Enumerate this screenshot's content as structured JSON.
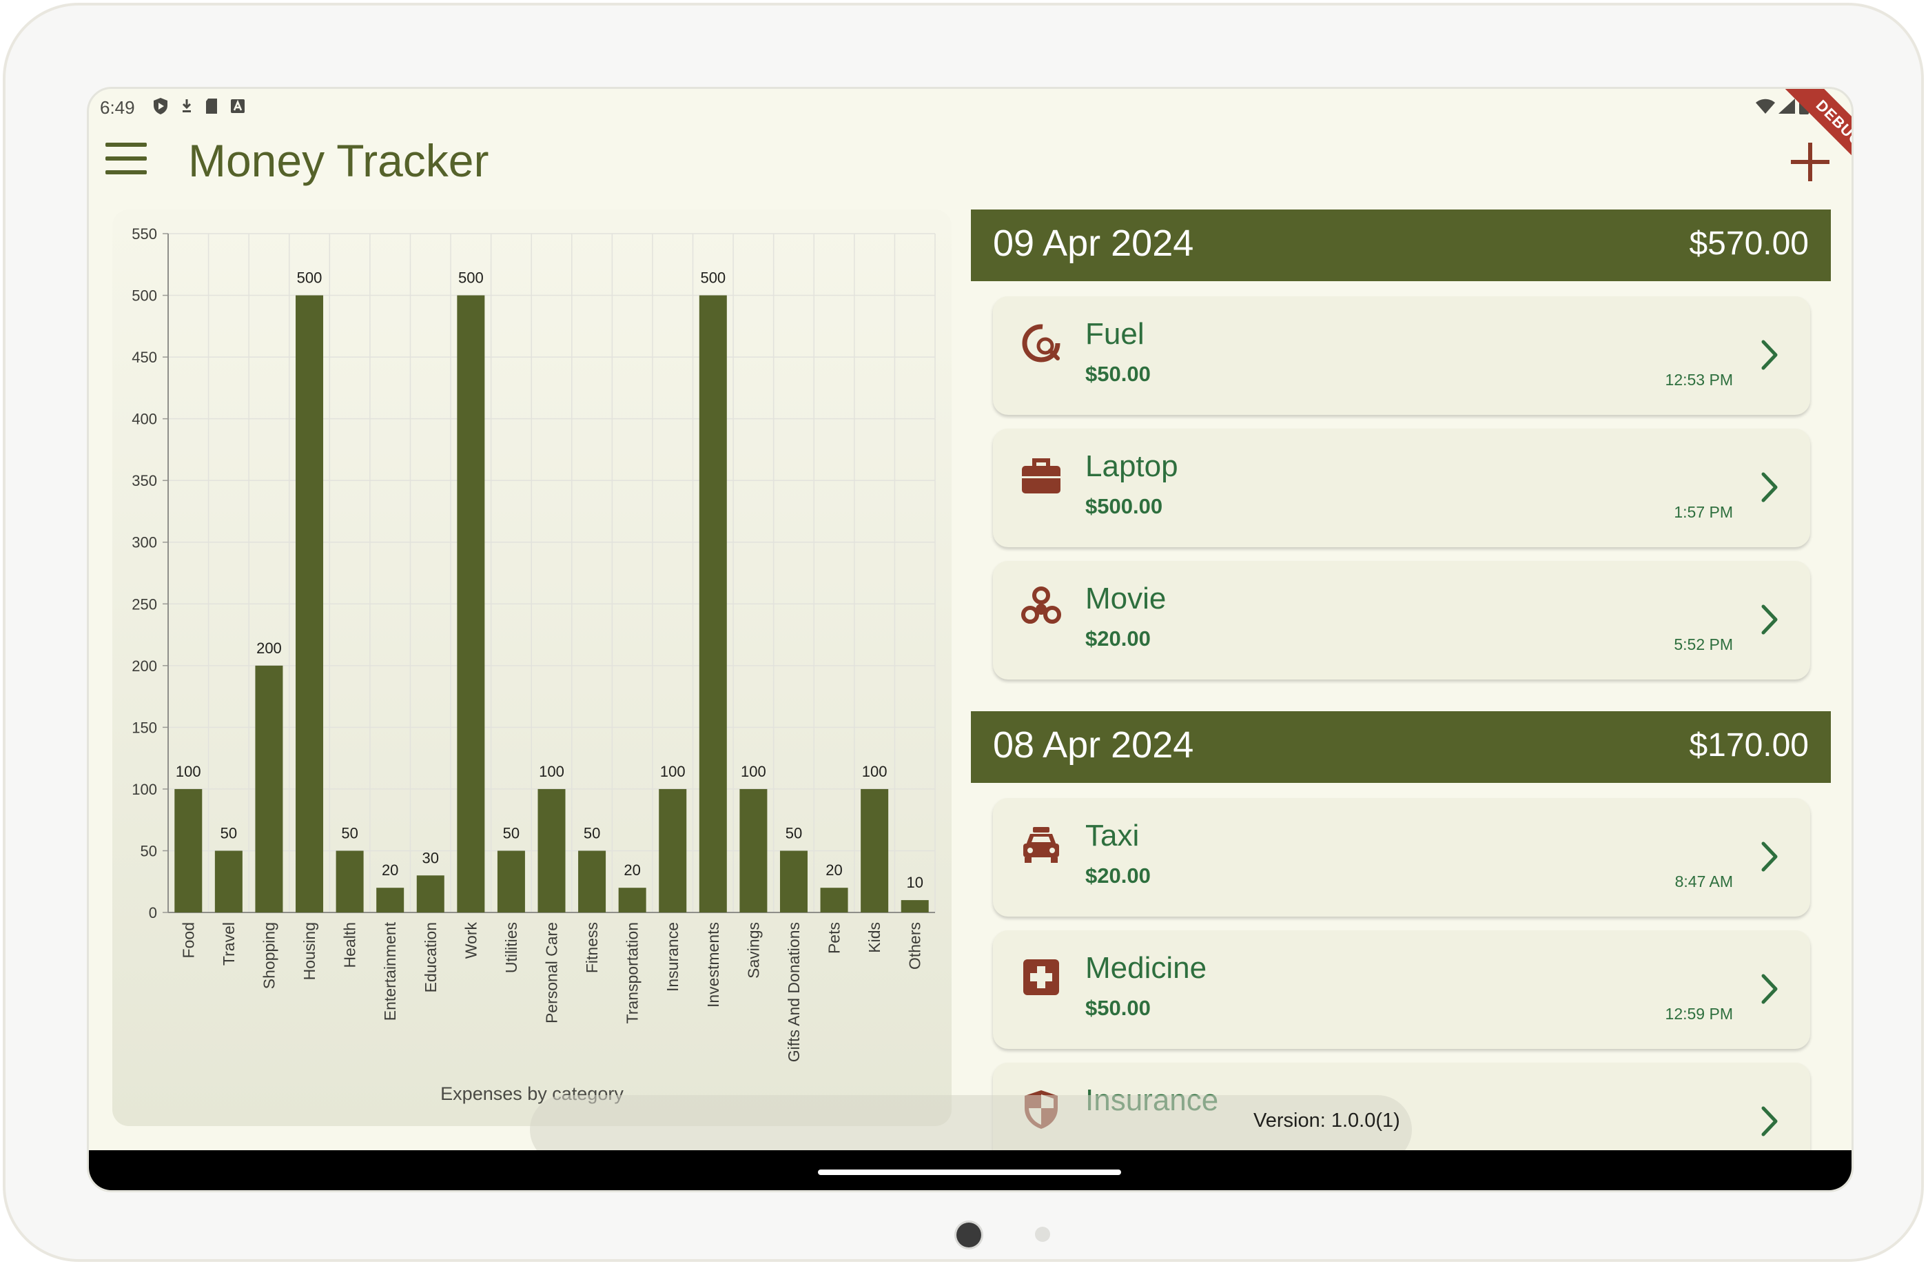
{
  "status_bar": {
    "time": "6:49"
  },
  "app": {
    "title": "Money Tracker"
  },
  "debug_banner": "DEBUG",
  "chart_data": {
    "type": "bar",
    "title": "Expenses by category",
    "categories": [
      "Food",
      "Travel",
      "Shopping",
      "Housing",
      "Health",
      "Entertainment",
      "Education",
      "Work",
      "Utilities",
      "Personal Care",
      "Fitness",
      "Transportation",
      "Insurance",
      "Investments",
      "Savings",
      "Gifts And Donations",
      "Pets",
      "Kids",
      "Others"
    ],
    "values": [
      100,
      50,
      200,
      500,
      50,
      20,
      30,
      500,
      50,
      100,
      50,
      20,
      100,
      500,
      100,
      50,
      20,
      100,
      10
    ],
    "ylim": [
      0,
      550
    ],
    "yticks": [
      0,
      50,
      100,
      150,
      200,
      250,
      300,
      350,
      400,
      450,
      500,
      550
    ],
    "grid": true,
    "bar_color": "#55622a"
  },
  "days": [
    {
      "date": "09 Apr 2024",
      "total": "$570.00",
      "transactions": [
        {
          "name": "Fuel",
          "amount": "$50.00",
          "time": "12:53 PM",
          "icon": "fuel-search-icon"
        },
        {
          "name": "Laptop",
          "amount": "$500.00",
          "time": "1:57 PM",
          "icon": "briefcase-icon"
        },
        {
          "name": "Movie",
          "amount": "$20.00",
          "time": "5:52 PM",
          "icon": "entertainment-icon"
        }
      ]
    },
    {
      "date": "08 Apr 2024",
      "total": "$170.00",
      "transactions": [
        {
          "name": "Taxi",
          "amount": "$20.00",
          "time": "8:47 AM",
          "icon": "taxi-icon"
        },
        {
          "name": "Medicine",
          "amount": "$50.00",
          "time": "12:59 PM",
          "icon": "medical-cross-icon"
        },
        {
          "name": "Insurance",
          "amount": "",
          "time": "",
          "icon": "shield-icon"
        }
      ]
    }
  ],
  "version": "Version: 1.0.0(1)",
  "colors": {
    "accent": "#55622a",
    "icon": "#8a3a28",
    "text_green": "#2e6f3e",
    "background": "#f8f8ec",
    "card": "#f1f1e1"
  }
}
